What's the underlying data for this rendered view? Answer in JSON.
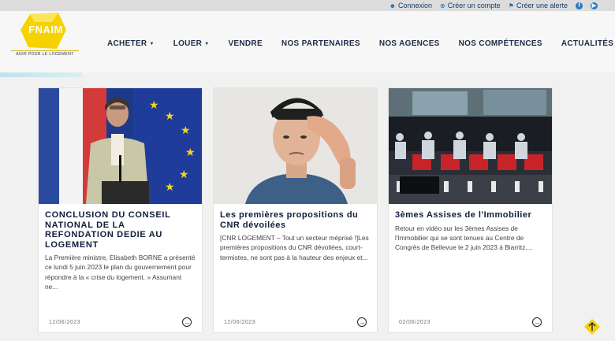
{
  "topbar": {
    "links": [
      {
        "icon": "user-icon",
        "label": "Connexion"
      },
      {
        "icon": "plus-icon",
        "label": "Créer un compte"
      },
      {
        "icon": "bell-icon",
        "label": "Créer une alerte"
      }
    ],
    "social": [
      "facebook-icon",
      "youtube-icon"
    ]
  },
  "logo": {
    "name": "FNAIM",
    "tagline": "AGIR POUR LE LOGEMENT",
    "color": "#f5d200"
  },
  "nav": {
    "items": [
      {
        "label": "ACHETER",
        "dropdown": true
      },
      {
        "label": "LOUER",
        "dropdown": true
      },
      {
        "label": "VENDRE",
        "dropdown": false
      },
      {
        "label": "NOS PARTENAIRES",
        "dropdown": false
      },
      {
        "label": "NOS AGENCES",
        "dropdown": false
      },
      {
        "label": "NOS COMPÉTENCES",
        "dropdown": false
      },
      {
        "label": "ACTUALITÉS",
        "dropdown": false
      }
    ]
  },
  "cards": [
    {
      "title": "CONCLUSION DU CONSEIL NATIONAL DE LA REFONDATION DEDIE AU LOGEMENT",
      "text": "La Première ministre, Elisabeth BORNE a présenté ce lundi 5 juin 2023 le plan du gouvernement pour répondre à la « crise du logement. » Assumant ne...",
      "date": "12/06/2023"
    },
    {
      "title": "Les premières propositions du CNR dévoilées",
      "text": "[CNR LOGEMENT – Tout un secteur méprisé !]Les premières propositions du CNR dévoilées, court-termistes, ne sont pas à la hauteur des enjeux et...",
      "date": "12/06/2023"
    },
    {
      "title": "3èmes Assises de l'Immobilier",
      "text": "Retour en vidéo sur les 3èmes Assises de l'Immobilier qui se sont tenues au Centre de Congrès de Bellevue le 2 juin 2023 à Biarritz....",
      "date": "02/06/2023"
    }
  ],
  "colors": {
    "accent": "#f5d200",
    "navText": "#1c2b45",
    "titleText": "#101c3b"
  }
}
